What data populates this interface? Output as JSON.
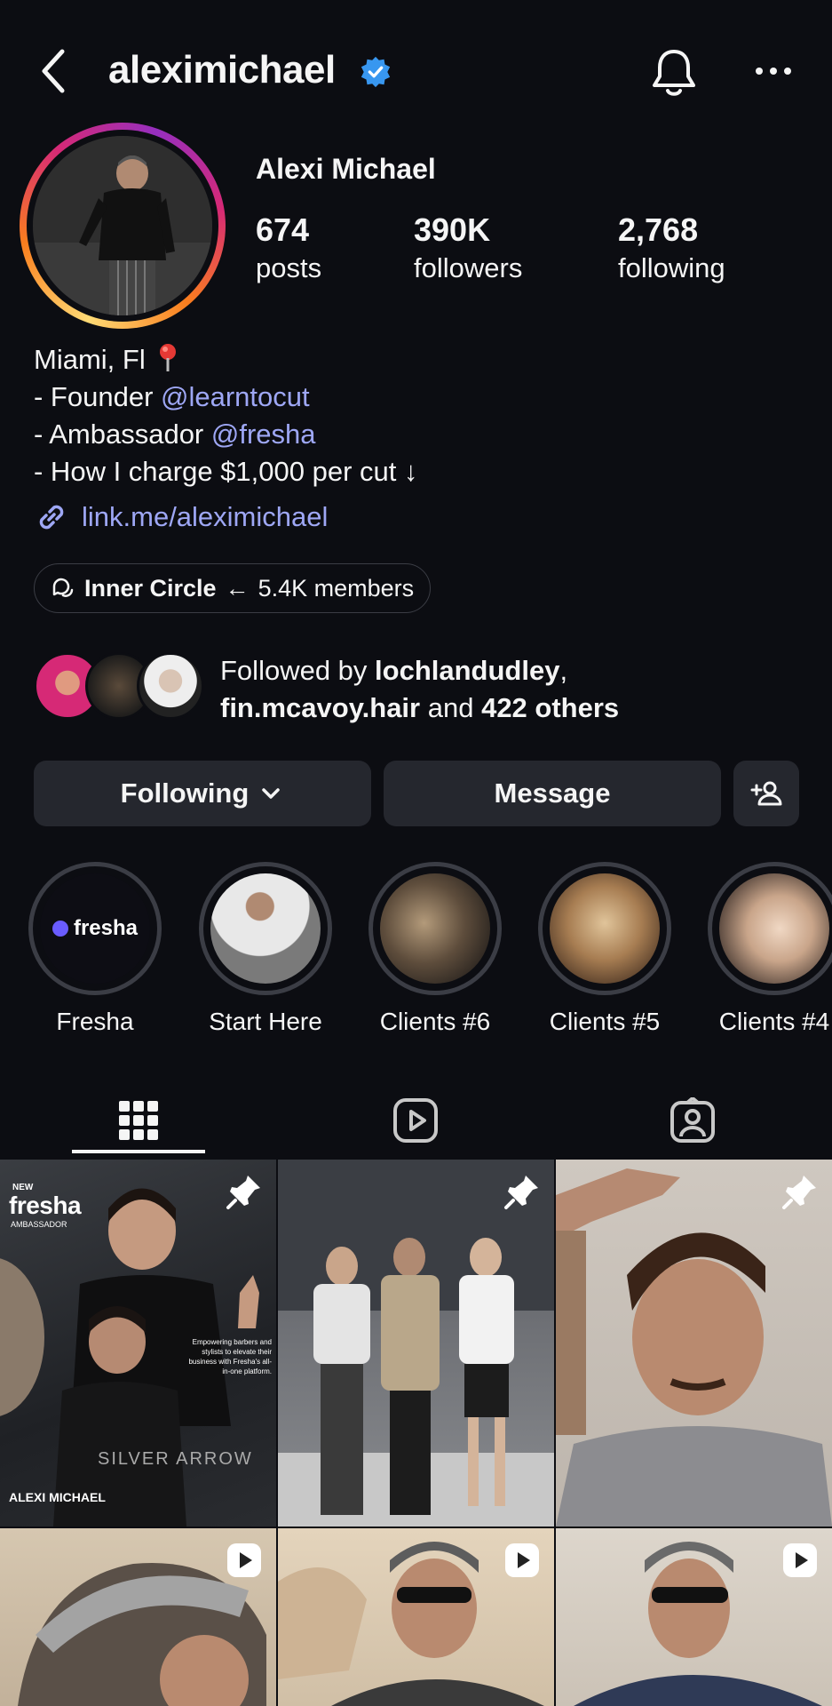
{
  "header": {
    "username": "aleximichael",
    "icons": {
      "back": "chevron-left-icon",
      "verified": "verified-badge-icon",
      "bell": "bell-icon",
      "more": "more-horizontal-icon"
    }
  },
  "profile": {
    "display_name": "Alexi Michael",
    "stats": [
      {
        "value": "674",
        "label": "posts"
      },
      {
        "value": "390K",
        "label": "followers"
      },
      {
        "value": "2,768",
        "label": "following"
      }
    ],
    "bio": {
      "location": "Miami, Fl",
      "line2_prefix": "- Founder ",
      "line2_mention": "@learntocut",
      "line3_prefix": "- Ambassador ",
      "line3_mention": "@fresha",
      "line4": "- How I charge $1,000 per cut ↓"
    },
    "link": "link.me/aleximichael",
    "channel": {
      "name": "Inner Circle",
      "arrow": "←",
      "members": "5.4K members"
    },
    "followed_by": {
      "prefix": "Followed by ",
      "user1": "lochlandudley",
      "sep": ",",
      "user2": "fin.mcavoy.hair",
      "mid": " and ",
      "others": "422 others"
    }
  },
  "actions": {
    "following_label": "Following",
    "message_label": "Message"
  },
  "highlights": [
    {
      "label": "Fresha",
      "logo": "fresha"
    },
    {
      "label": "Start Here"
    },
    {
      "label": "Clients #6"
    },
    {
      "label": "Clients #5"
    },
    {
      "label": "Clients #4"
    }
  ],
  "tabs": [
    {
      "icon": "grid-icon",
      "active": true
    },
    {
      "icon": "reels-icon",
      "active": false
    },
    {
      "icon": "tagged-icon",
      "active": false
    }
  ],
  "grid": {
    "post1": {
      "top_small": "NEW",
      "brand": "fresha",
      "sub": "AMBASSADOR",
      "blurb": "Empowering barbers and stylists to elevate their business with Fresha's all-in-one platform.",
      "name": "ALEXI MICHAEL",
      "shirt": "SILVER ARROW"
    }
  },
  "colors": {
    "background": "#0c0d12",
    "button": "#25272e",
    "mention": "#9ea7f5",
    "verified": "#3897f0"
  }
}
